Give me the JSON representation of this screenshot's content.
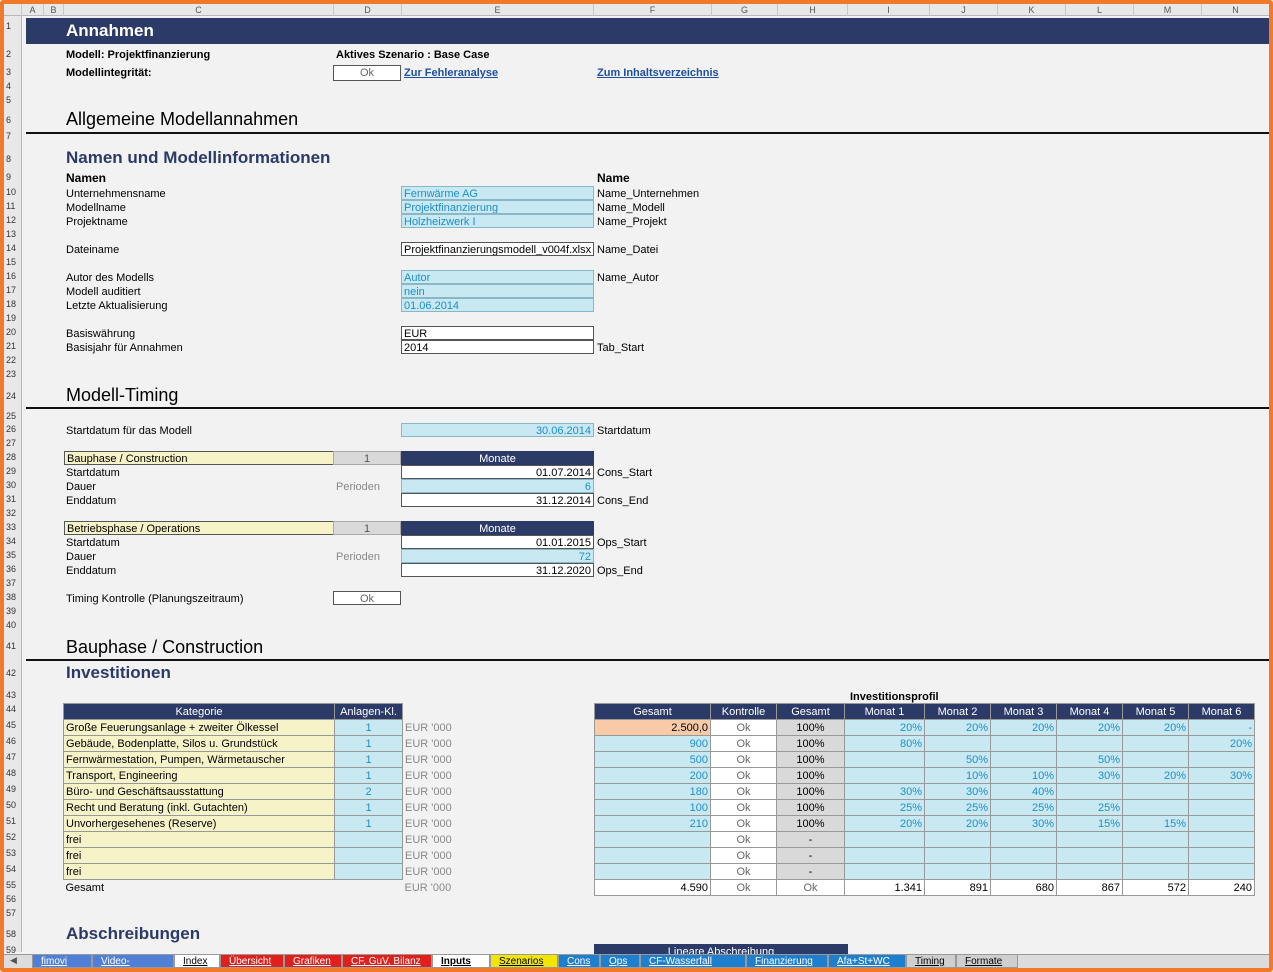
{
  "columns": [
    "A",
    "B",
    "C",
    "D",
    "E",
    "F",
    "G",
    "H",
    "I",
    "J",
    "K",
    "L",
    "M",
    "N"
  ],
  "banner": "Annahmen",
  "model": {
    "label": "Modell: Projektfinanzierung",
    "scenario": "Aktives Szenario : Base Case",
    "integrity_label": "Modellintegrität:",
    "integrity_value": "Ok",
    "link_errors": "Zur Fehleranalyse",
    "link_toc": "Zum Inhaltsverzeichnis"
  },
  "section_general": "Allgemeine Modellannahmen",
  "section_names": "Namen und Modellinformationen",
  "names_header": "Namen",
  "name_header": "Name",
  "name_rows": [
    {
      "label": "Unternehmensname",
      "value": "Fernwärme AG",
      "name": "Name_Unternehmen"
    },
    {
      "label": "Modellname",
      "value": "Projektfinanzierung",
      "name": "Name_Modell"
    },
    {
      "label": "Projektname",
      "value": "Holzheizwerk I",
      "name": "Name_Projekt"
    },
    {
      "label": "Dateiname",
      "value": "Projektfinanzierungsmodell_v004f.xlsx",
      "name": "Name_Datei"
    },
    {
      "label": "Autor des Modells",
      "value": "Autor",
      "name": "Name_Autor"
    },
    {
      "label": "Modell auditiert",
      "value": "nein",
      "name": ""
    },
    {
      "label": "Letzte Aktualisierung",
      "value": "01.06.2014",
      "name": ""
    },
    {
      "label": "Basiswährung",
      "value": "EUR",
      "name": ""
    },
    {
      "label": "Basisjahr für Annahmen",
      "value": "2014",
      "name": "Tab_Start"
    }
  ],
  "section_timing": "Modell-Timing",
  "timing": {
    "start_label": "Startdatum für das Modell",
    "start_value": "30.06.2014",
    "start_name": "Startdatum",
    "cons_label": "Bauphase / Construction",
    "cons_num": "1",
    "months": "Monate",
    "cons_start_label": "Startdatum",
    "cons_start": "01.07.2014",
    "cons_start_name": "Cons_Start",
    "cons_dur_label": "Dauer",
    "perioden": "Perioden",
    "cons_dur": "6",
    "cons_end_label": "Enddatum",
    "cons_end": "31.12.2014",
    "cons_end_name": "Cons_End",
    "ops_label": "Betriebsphase / Operations",
    "ops_num": "1",
    "ops_start_label": "Startdatum",
    "ops_start": "01.01.2015",
    "ops_start_name": "Ops_Start",
    "ops_dur_label": "Dauer",
    "ops_dur": "72",
    "ops_end_label": "Enddatum",
    "ops_end": "31.12.2020",
    "ops_end_name": "Ops_End",
    "control_label": "Timing Kontrolle (Planungszeitraum)",
    "control_value": "Ok"
  },
  "section_construction": "Bauphase / Construction",
  "section_invest": "Investitionen",
  "invest": {
    "profile_label": "Investitionsprofil",
    "headers": [
      "Kategorie",
      "Anlagen-Kl.",
      "Gesamt",
      "Kontrolle",
      "Gesamt",
      "Monat 1",
      "Monat 2",
      "Monat 3",
      "Monat 4",
      "Monat 5",
      "Monat 6"
    ],
    "unit": "EUR '000",
    "rows": [
      {
        "cat": "Große Feuerungsanlage + zweiter Ölkessel",
        "cls": "1",
        "total": "2.500,0",
        "ctrl": "Ok",
        "pct": "100%",
        "m": [
          "20%",
          "20%",
          "20%",
          "20%",
          "20%",
          "-"
        ]
      },
      {
        "cat": "Gebäude, Bodenplatte, Silos u. Grundstück",
        "cls": "1",
        "total": "900",
        "ctrl": "Ok",
        "pct": "100%",
        "m": [
          "80%",
          "",
          "",
          "",
          "",
          "20%"
        ]
      },
      {
        "cat": "Fernwärmestation, Pumpen, Wärmetauscher",
        "cls": "1",
        "total": "500",
        "ctrl": "Ok",
        "pct": "100%",
        "m": [
          "",
          "50%",
          "",
          "50%",
          "",
          ""
        ]
      },
      {
        "cat": "Transport, Engineering",
        "cls": "1",
        "total": "200",
        "ctrl": "Ok",
        "pct": "100%",
        "m": [
          "",
          "10%",
          "10%",
          "30%",
          "20%",
          "30%"
        ]
      },
      {
        "cat": "Büro- und Geschäftsausstattung",
        "cls": "2",
        "total": "180",
        "ctrl": "Ok",
        "pct": "100%",
        "m": [
          "30%",
          "30%",
          "40%",
          "",
          "",
          ""
        ]
      },
      {
        "cat": "Recht und Beratung (inkl. Gutachten)",
        "cls": "1",
        "total": "100",
        "ctrl": "Ok",
        "pct": "100%",
        "m": [
          "25%",
          "25%",
          "25%",
          "25%",
          "",
          ""
        ]
      },
      {
        "cat": "Unvorhergesehenes (Reserve)",
        "cls": "1",
        "total": "210",
        "ctrl": "Ok",
        "pct": "100%",
        "m": [
          "20%",
          "20%",
          "30%",
          "15%",
          "15%",
          ""
        ]
      },
      {
        "cat": "frei",
        "cls": "",
        "total": "",
        "ctrl": "Ok",
        "pct": "-",
        "m": [
          "",
          "",
          "",
          "",
          "",
          ""
        ]
      },
      {
        "cat": "frei",
        "cls": "",
        "total": "",
        "ctrl": "Ok",
        "pct": "-",
        "m": [
          "",
          "",
          "",
          "",
          "",
          ""
        ]
      },
      {
        "cat": "frei",
        "cls": "",
        "total": "",
        "ctrl": "Ok",
        "pct": "-",
        "m": [
          "",
          "",
          "",
          "",
          "",
          ""
        ]
      }
    ],
    "total_row": {
      "cat": "Gesamt",
      "total": "4.590",
      "ctrl": "Ok",
      "pct": "Ok",
      "m": [
        "1.341",
        "891",
        "680",
        "867",
        "572",
        "240"
      ]
    }
  },
  "section_depr": "Abschreibungen",
  "depr_header": "Lineare Abschreibung",
  "sheet_tabs": [
    {
      "label": "fimovi",
      "color": "#4f7fd6",
      "active": false
    },
    {
      "label": "Video-Training",
      "color": "#4f7fd6",
      "active": false
    },
    {
      "label": "Index",
      "color": "#ffffff",
      "active": false
    },
    {
      "label": "Übersicht",
      "color": "#e0201c",
      "active": false
    },
    {
      "label": "Grafiken",
      "color": "#e0201c",
      "active": false
    },
    {
      "label": "CF, GuV, Bilanz",
      "color": "#e0201c",
      "active": false
    },
    {
      "label": "Inputs",
      "color": "#ffffff",
      "active": true
    },
    {
      "label": "Szenarios",
      "color": "#f2e600",
      "active": false
    },
    {
      "label": "Cons",
      "color": "#1e7fcf",
      "active": false
    },
    {
      "label": "Ops",
      "color": "#1e7fcf",
      "active": false
    },
    {
      "label": "CF-Wasserfall",
      "color": "#1e7fcf",
      "active": false
    },
    {
      "label": "Finanzierung",
      "color": "#1e7fcf",
      "active": false
    },
    {
      "label": "Afa+St+WC",
      "color": "#1e7fcf",
      "active": false
    },
    {
      "label": "Timing",
      "color": "#cfcfcf",
      "active": false
    },
    {
      "label": "Formate",
      "color": "#cfcfcf",
      "active": false
    }
  ]
}
